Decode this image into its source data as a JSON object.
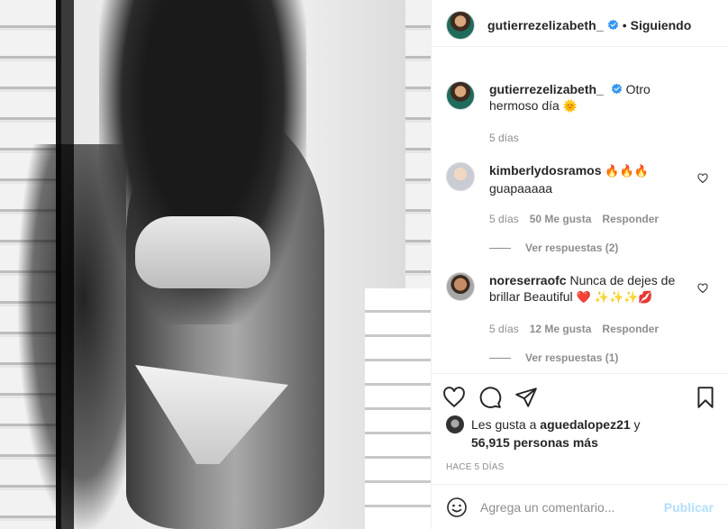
{
  "header": {
    "username": "gutierrezelizabeth_",
    "separator": "•",
    "follow_status": "Siguiendo"
  },
  "caption": {
    "username": "gutierrezelizabeth_",
    "text": "Otro hermoso día",
    "emoji": "🌞",
    "age": "5 días"
  },
  "comments": [
    {
      "username": "kimberlydosramos",
      "text": "guapaaaaa",
      "emoji_suffix": "🔥🔥🔥",
      "age": "5 días",
      "likes": "50 Me gusta",
      "reply_label": "Responder",
      "replies_label": "Ver respuestas (2)"
    },
    {
      "username": "noreserraofc",
      "text": "Nunca de dejes de brillar Beautiful",
      "emoji_suffix": "❤️ ✨✨✨💋",
      "age": "5 días",
      "likes": "12 Me gusta",
      "reply_label": "Responder",
      "replies_label": "Ver respuestas (1)"
    }
  ],
  "likes_line": {
    "prefix": "Les gusta a ",
    "user": "aguedalopez21",
    "middle": " y",
    "count": "56,915 personas más"
  },
  "timestamp": "HACE 5 DÍAS",
  "add_comment": {
    "placeholder": "Agrega un comentario...",
    "publish_label": "Publicar"
  },
  "icons": {
    "like": "heart-icon",
    "comment": "comment-icon",
    "share": "share-icon",
    "save": "bookmark-icon",
    "emoji": "emoji-icon",
    "verified": "verified-badge-icon"
  },
  "colors": {
    "verified": "#3897f0",
    "publish_disabled": "#b2dffc",
    "muted": "#8e8e8e"
  }
}
